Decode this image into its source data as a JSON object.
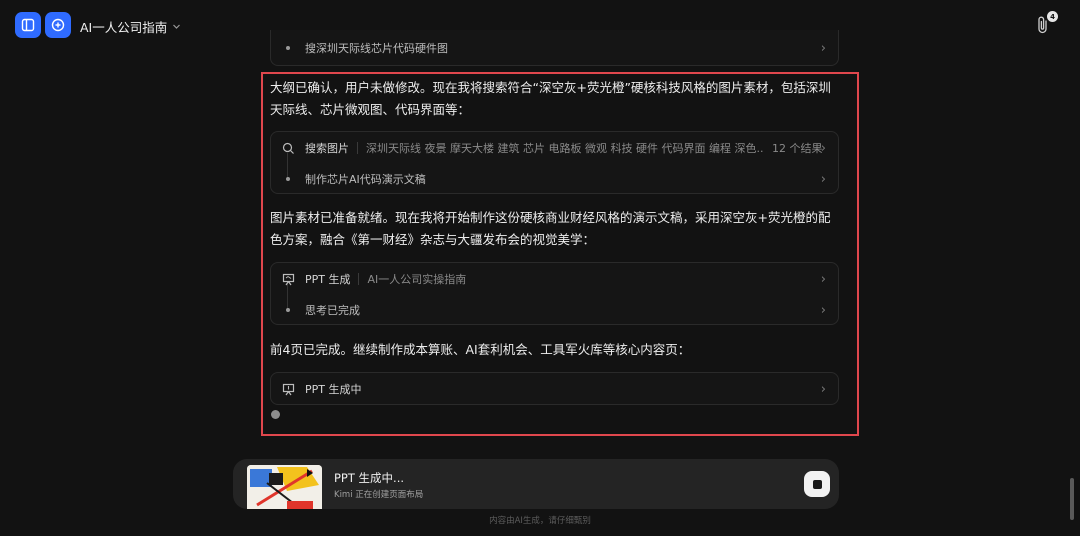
{
  "header": {
    "title": "AI一人公司指南",
    "attachment_count": "4"
  },
  "top_card": {
    "item_label": "搜深圳天际线芯片代码硬件图"
  },
  "messages": [
    {
      "text": "大纲已确认，用户未做修改。现在我将搜索符合“深空灰+荧光橙”硬核科技风格的图片素材，包括深圳天际线、芯片微观图、代码界面等："
    },
    {
      "text": "图片素材已准备就绪。现在我将开始制作这份硬核商业财经风格的演示文稿，采用深空灰+荧光橙的配色方案，融合《第一财经》杂志与大疆发布会的视觉美学："
    },
    {
      "text": "前4页已完成。继续制作成本算账、AI套利机会、工具军火库等核心内容页："
    }
  ],
  "search_card": {
    "tool_label": "搜索图片",
    "query": "深圳天际线 夜景 摩天大楼 建筑 芯片 电路板 微观 科技 硬件 代码界面 编程 深色...",
    "result_count": "12 个结果",
    "step_label": "制作芯片AI代码演示文稿"
  },
  "ppt_card": {
    "tool_label": "PPT 生成",
    "doc_title": "AI一人公司实操指南",
    "step_label": "思考已完成"
  },
  "ppt_progress_card": {
    "tool_label": "PPT 生成中"
  },
  "bottom_bar": {
    "title": "PPT 生成中...",
    "subtitle": "Kimi 正在创建页面布局"
  },
  "footer": {
    "note": "内容由AI生成，请仔细甄别"
  },
  "colors": {
    "accent_blue": "#2f6bff",
    "highlight_red": "#e0474d",
    "background": "#121212"
  }
}
